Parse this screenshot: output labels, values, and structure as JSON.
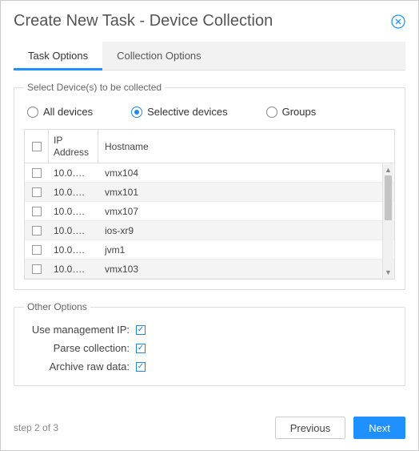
{
  "dialog": {
    "title": "Create New Task - Device Collection"
  },
  "tabs": [
    {
      "label": "Task Options",
      "active": true
    },
    {
      "label": "Collection Options",
      "active": false
    }
  ],
  "select_devices": {
    "legend": "Select Device(s) to be collected",
    "radios": {
      "all": "All devices",
      "selective": "Selective devices",
      "groups": "Groups",
      "selected": "selective"
    },
    "columns": {
      "ip": "IP Address",
      "hostname": "Hostname"
    },
    "rows": [
      {
        "ip": "10.0….",
        "hostname": "vmx104"
      },
      {
        "ip": "10.0….",
        "hostname": "vmx101"
      },
      {
        "ip": "10.0….",
        "hostname": "vmx107"
      },
      {
        "ip": "10.0….",
        "hostname": "ios-xr9"
      },
      {
        "ip": "10.0….",
        "hostname": "jvm1"
      },
      {
        "ip": "10.0….",
        "hostname": "vmx103"
      }
    ]
  },
  "other_options": {
    "legend": "Other Options",
    "use_mgmt_ip": {
      "label": "Use management IP:",
      "checked": true
    },
    "parse_collection": {
      "label": "Parse collection:",
      "checked": true
    },
    "archive_raw": {
      "label": "Archive raw data:",
      "checked": true
    }
  },
  "footer": {
    "step": "step 2 of 3",
    "previous": "Previous",
    "next": "Next"
  }
}
